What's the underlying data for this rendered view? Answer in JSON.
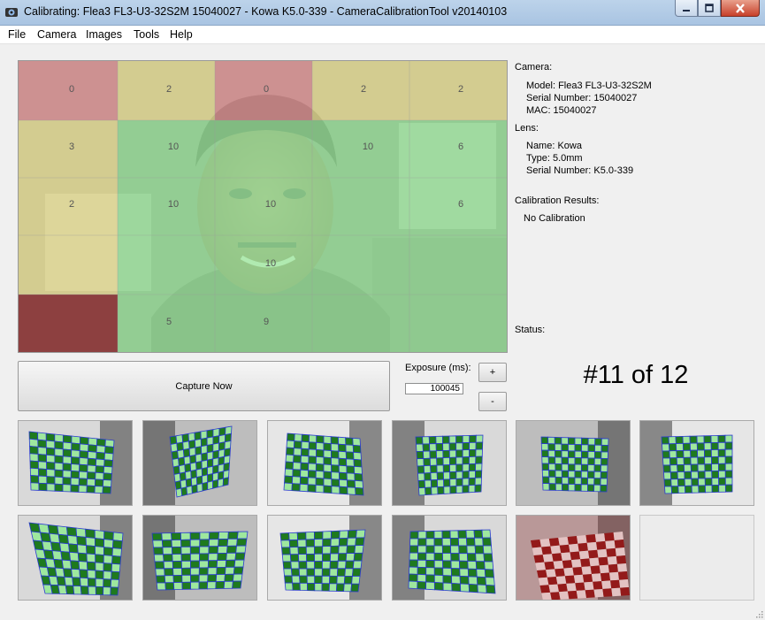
{
  "window": {
    "title": "Calibrating: Flea3 FL3-U3-32S2M 15040027  -  Kowa K5.0-339 - CameraCalibrationTool v20140103"
  },
  "menu": [
    "File",
    "Camera",
    "Images",
    "Tools",
    "Help"
  ],
  "grid": {
    "labels": [
      "0",
      "2",
      "0",
      "2",
      "2",
      "3",
      "10",
      "10",
      "6",
      "2",
      "10",
      "10",
      "6",
      "10",
      "5",
      "9"
    ]
  },
  "camera": {
    "heading": "Camera:",
    "model": "Model: Flea3 FL3-U3-32S2M",
    "serial": "Serial Number: 15040027",
    "mac": "MAC: 15040027"
  },
  "lens": {
    "heading": "Lens:",
    "name": "Name: Kowa",
    "type": "Type: 5.0mm",
    "serial": "Serial Number: K5.0-339"
  },
  "calibration": {
    "heading": "Calibration Results:",
    "value": "No Calibration"
  },
  "status": {
    "heading": "Status:"
  },
  "controls": {
    "capture_label": "Capture Now",
    "exposure_label": "Exposure (ms):",
    "exposure_value": "100045",
    "plus_label": "+",
    "minus_label": "-",
    "counter": "#11 of 12"
  },
  "thumbnails": [
    {
      "state": "captured",
      "shown": true
    },
    {
      "state": "captured",
      "shown": true
    },
    {
      "state": "captured",
      "shown": true
    },
    {
      "state": "captured",
      "shown": true
    },
    {
      "state": "captured",
      "shown": true
    },
    {
      "state": "captured",
      "shown": true
    },
    {
      "state": "captured",
      "shown": true
    },
    {
      "state": "captured",
      "shown": true
    },
    {
      "state": "captured",
      "shown": true
    },
    {
      "state": "captured",
      "shown": true
    },
    {
      "state": "rejected",
      "shown": true
    },
    {
      "state": "empty",
      "shown": false
    }
  ],
  "colors": {
    "zone_red": "#e89b9b",
    "zone_yellow": "#efe79a",
    "zone_green": "#9ee89e",
    "grid_blue": "#2a3ad0",
    "checker_green": "#1e7a1e",
    "checker_red": "#8a1414"
  }
}
